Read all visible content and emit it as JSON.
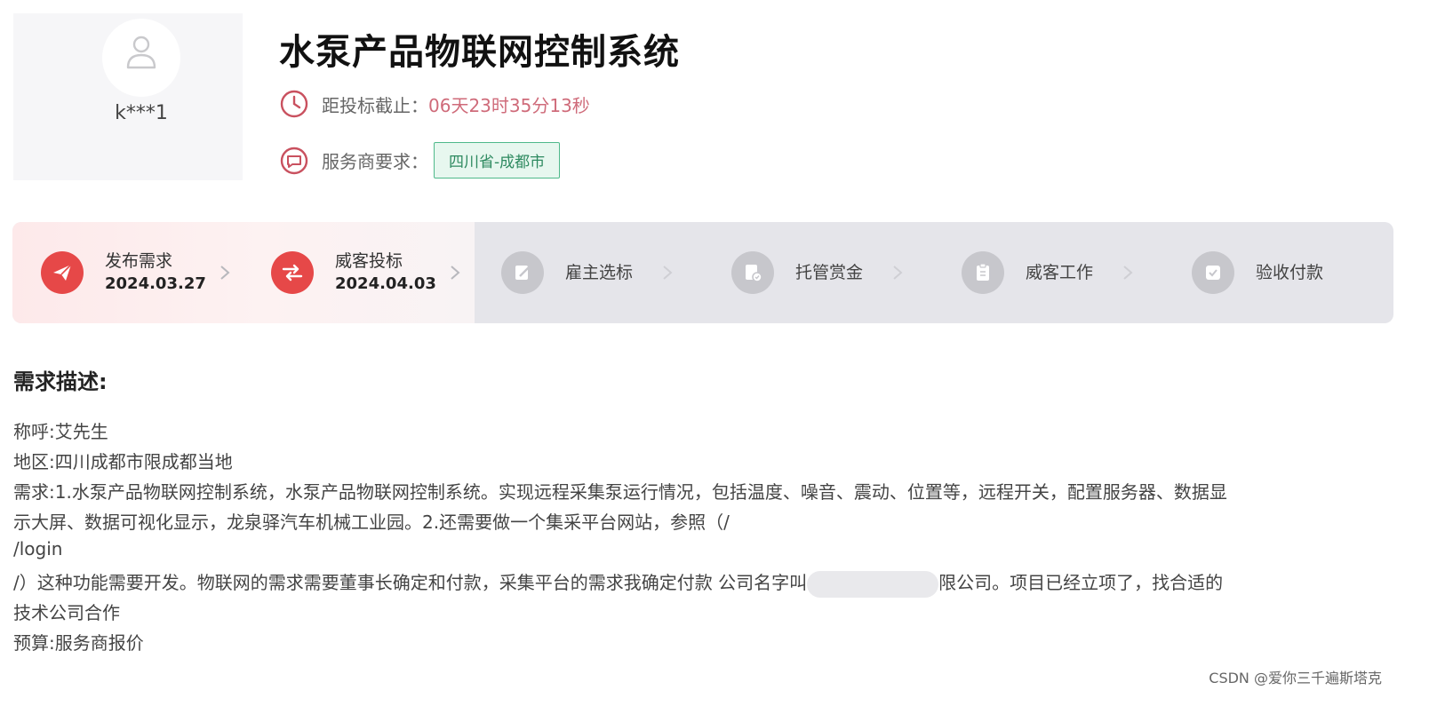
{
  "user": {
    "name": "k***1"
  },
  "project": {
    "title": "水泵产品物联网控制系统",
    "deadline_label": "距投标截止：",
    "deadline_countdown": "06天23时35分13秒",
    "provider_label": "服务商要求：",
    "provider_region": "四川省-成都市"
  },
  "steps": [
    {
      "label": "发布需求",
      "date": "2024.03.27",
      "state": "done",
      "icon": "send-icon"
    },
    {
      "label": "威客投标",
      "date": "2024.04.03",
      "state": "done",
      "icon": "bid-icon"
    },
    {
      "label": "雇主选标",
      "date": "",
      "state": "todo",
      "icon": "select-icon"
    },
    {
      "label": "托管赏金",
      "date": "",
      "state": "todo",
      "icon": "escrow-icon"
    },
    {
      "label": "威客工作",
      "date": "",
      "state": "todo",
      "icon": "clipboard-icon"
    },
    {
      "label": "验收付款",
      "date": "",
      "state": "todo",
      "icon": "check-icon"
    }
  ],
  "description": {
    "heading": "需求描述:",
    "lines": [
      "称呼:艾先生",
      "地区:四川成都市限成都当地",
      "需求:1.水泵产品物联网控制系统，水泵产品物联网控制系统。实现远程采集泵运行情况，包括温度、噪音、震动、位置等，远程开关，配置服务器、数据显",
      "示大屏、数据可视化显示，龙泉驿汽车机械工业园。2.还需要做一个集采平台网站，参照（/",
      "/login",
      "/）这种功能需要开发。物联网的需求需要董事长确定和付款，采集平台的需求我确定付款 公司名字叫",
      "限公司。项目已经立项了，找合适的",
      "技术公司合作",
      "预算:服务商报价"
    ]
  },
  "watermark": "CSDN @爱你三千遍斯塔克",
  "colors": {
    "accent_red": "#e64848",
    "countdown": "#cf6b7a",
    "tag_green": "#4fb98b",
    "step_inactive": "#c7c7cc"
  }
}
